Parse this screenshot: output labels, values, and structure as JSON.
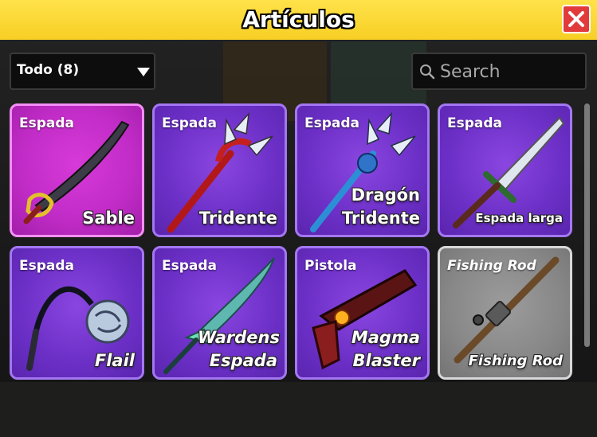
{
  "header": {
    "title": "Artículos"
  },
  "filter": {
    "selected": "Todo (8)"
  },
  "search": {
    "placeholder": "Search"
  },
  "items": [
    {
      "category": "Espada",
      "name": "Sable",
      "rarity_color": "#c02bc6"
    },
    {
      "category": "Espada",
      "name": "Tridente",
      "rarity_color": "#6b2fc6"
    },
    {
      "category": "Espada",
      "name": "Dragón Tridente",
      "rarity_color": "#6b2fc6"
    },
    {
      "category": "Espada",
      "name": "Espada larga",
      "rarity_color": "#6b2fc6"
    },
    {
      "category": "Espada",
      "name": "Flail",
      "rarity_color": "#6b2fc6"
    },
    {
      "category": "Espada",
      "name": "Wardens Espada",
      "rarity_color": "#6b2fc6"
    },
    {
      "category": "Pistola",
      "name": "Magma Blaster",
      "rarity_color": "#6b2fc6"
    },
    {
      "category": "Fishing Rod",
      "name": "Fishing Rod",
      "rarity_color": "#878787"
    }
  ],
  "icons": [
    "close-icon",
    "chevron-down-icon",
    "search-icon"
  ]
}
